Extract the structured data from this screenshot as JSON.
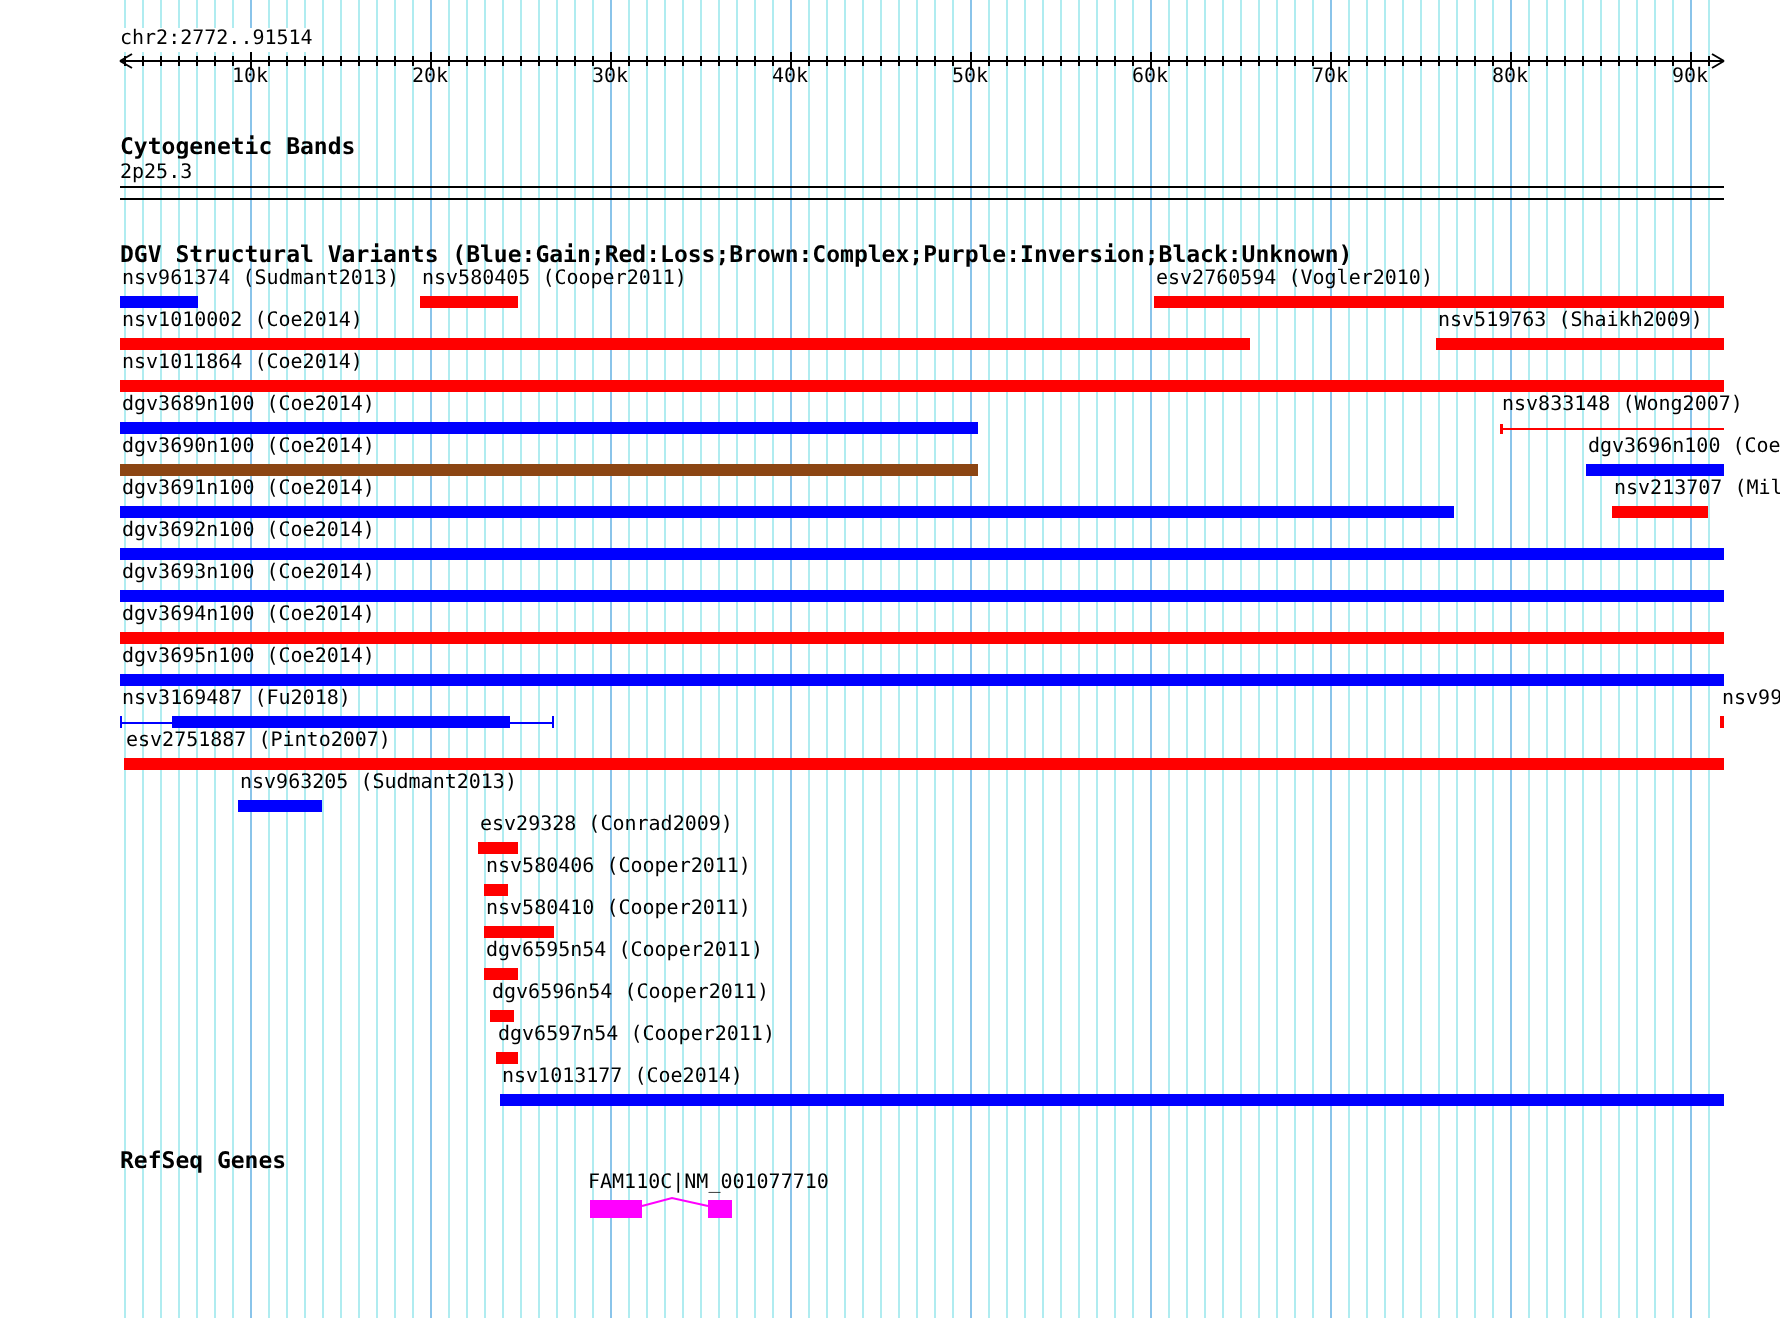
{
  "ruler": {
    "location": "chr2:2772..91514",
    "ticks": [
      "10k",
      "20k",
      "30k",
      "40k",
      "50k",
      "60k",
      "70k",
      "80k",
      "90k"
    ]
  },
  "cytogenetic_bands": {
    "title": "Cytogenetic Bands",
    "band": "2p25.3"
  },
  "variants": {
    "title": "DGV Structural Variants (Blue:Gain;Red:Loss;Brown:Complex;Purple:Inversion;Black:Unknown)",
    "rows": [
      {
        "features": [
          {
            "label": "nsv961374 (Sudmant2013)",
            "color": "#0000ff",
            "kind": "bar"
          },
          {
            "label": "nsv580405 (Cooper2011)",
            "color": "#ff0000",
            "kind": "bar"
          },
          {
            "label": "esv2760594 (Vogler2010)",
            "color": "#ff0000",
            "kind": "bar"
          }
        ]
      },
      {
        "features": [
          {
            "label": "nsv1010002 (Coe2014)",
            "color": "#ff0000",
            "kind": "bar"
          },
          {
            "label": "nsv519763 (Shaikh2009)",
            "color": "#ff0000",
            "kind": "bar"
          }
        ]
      },
      {
        "features": [
          {
            "label": "nsv1011864 (Coe2014)",
            "color": "#ff0000",
            "kind": "bar"
          }
        ]
      },
      {
        "features": [
          {
            "label": "dgv3689n100 (Coe2014)",
            "color": "#0000ff",
            "kind": "bar"
          },
          {
            "label": "nsv833148 (Wong2007)",
            "color": "#ff0000",
            "kind": "line"
          }
        ]
      },
      {
        "features": [
          {
            "label": "dgv3690n100 (Coe2014)",
            "color": "#8b4513",
            "kind": "bar"
          },
          {
            "label": "dgv3696n100 (Coe",
            "color": "#0000ff",
            "kind": "bar"
          }
        ]
      },
      {
        "features": [
          {
            "label": "dgv3691n100 (Coe2014)",
            "color": "#0000ff",
            "kind": "bar"
          },
          {
            "label": "nsv213707 (Mil",
            "color": "#ff0000",
            "kind": "bar"
          }
        ]
      },
      {
        "features": [
          {
            "label": "dgv3692n100 (Coe2014)",
            "color": "#0000ff",
            "kind": "bar"
          }
        ]
      },
      {
        "features": [
          {
            "label": "dgv3693n100 (Coe2014)",
            "color": "#0000ff",
            "kind": "bar"
          }
        ]
      },
      {
        "features": [
          {
            "label": "dgv3694n100 (Coe2014)",
            "color": "#ff0000",
            "kind": "bar"
          }
        ]
      },
      {
        "features": [
          {
            "label": "dgv3695n100 (Coe2014)",
            "color": "#0000ff",
            "kind": "bar"
          }
        ]
      },
      {
        "features": [
          {
            "label": "nsv3169487 (Fu2018)",
            "color": "#0000ff",
            "kind": "split"
          },
          {
            "label": "nsv99",
            "color": "#ff0000",
            "kind": "bar"
          }
        ]
      },
      {
        "features": [
          {
            "label": "esv2751887 (Pinto2007)",
            "color": "#ff0000",
            "kind": "bar"
          }
        ]
      },
      {
        "features": [
          {
            "label": "nsv963205 (Sudmant2013)",
            "color": "#0000ff",
            "kind": "bar"
          }
        ]
      },
      {
        "features": [
          {
            "label": "esv29328 (Conrad2009)",
            "color": "#ff0000",
            "kind": "bar"
          }
        ]
      },
      {
        "features": [
          {
            "label": "nsv580406 (Cooper2011)",
            "color": "#ff0000",
            "kind": "bar"
          }
        ]
      },
      {
        "features": [
          {
            "label": "nsv580410 (Cooper2011)",
            "color": "#ff0000",
            "kind": "bar"
          }
        ]
      },
      {
        "features": [
          {
            "label": "dgv6595n54 (Cooper2011)",
            "color": "#ff0000",
            "kind": "bar"
          }
        ]
      },
      {
        "features": [
          {
            "label": "dgv6596n54 (Cooper2011)",
            "color": "#ff0000",
            "kind": "bar"
          }
        ]
      },
      {
        "features": [
          {
            "label": "dgv6597n54 (Cooper2011)",
            "color": "#ff0000",
            "kind": "bar"
          }
        ]
      },
      {
        "features": [
          {
            "label": "nsv1013177 (Coe2014)",
            "color": "#0000ff",
            "kind": "bar"
          }
        ]
      }
    ]
  },
  "refseq_genes": {
    "title": "RefSeq Genes",
    "genes": [
      {
        "label": "FAM110C|NM_001077710",
        "color": "#ff00ff"
      }
    ]
  }
}
